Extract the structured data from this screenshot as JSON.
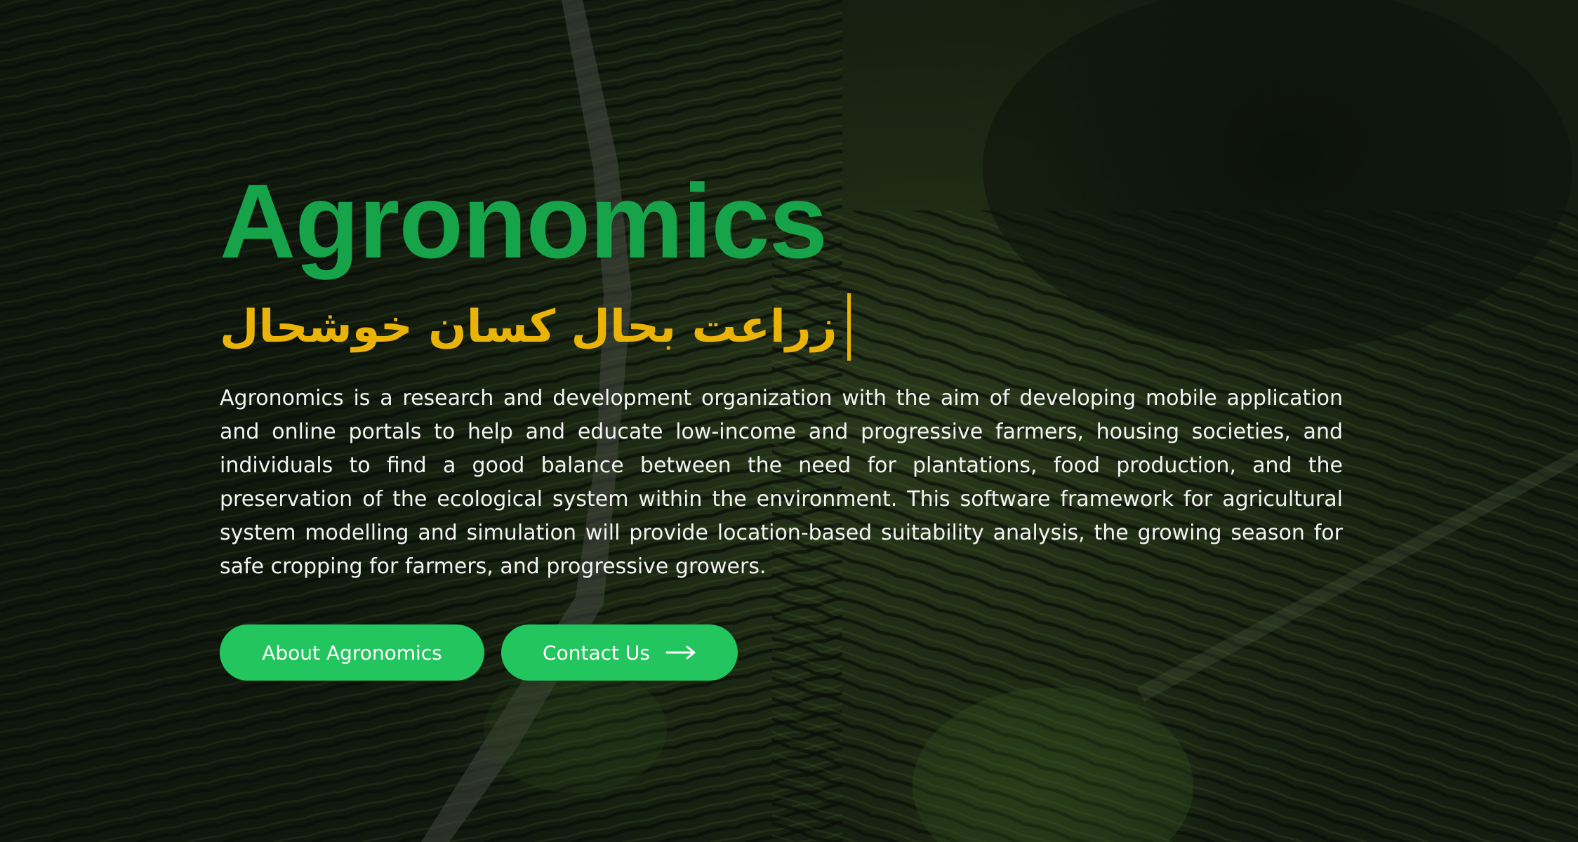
{
  "hero": {
    "title": "Agronomics",
    "tagline": "زراعت بحال کسان خوشحال",
    "description": "Agronomics is a research and development organization with the aim of developing mobile application and online portals to help and educate low-income and progressive farmers, housing societies, and individuals to find a good balance between the need for plantations, food production, and the preservation of the ecological system within the environment. This software framework for agricultural system modelling and simulation will provide location-based suitability analysis, the growing season for safe cropping for farmers, and progressive growers.",
    "buttons": {
      "about_label": "About Agronomics",
      "contact_label": "Contact Us",
      "contact_icon": "arrow-right-icon"
    }
  },
  "colors": {
    "title": "#16a34a",
    "tagline": "#eab308",
    "button_bg": "#22c55e",
    "button_text": "#ffffff",
    "body_text": "#f3f4f2"
  },
  "background": {
    "image": "aerial view of terraced green tea plantation with a dirt road"
  }
}
